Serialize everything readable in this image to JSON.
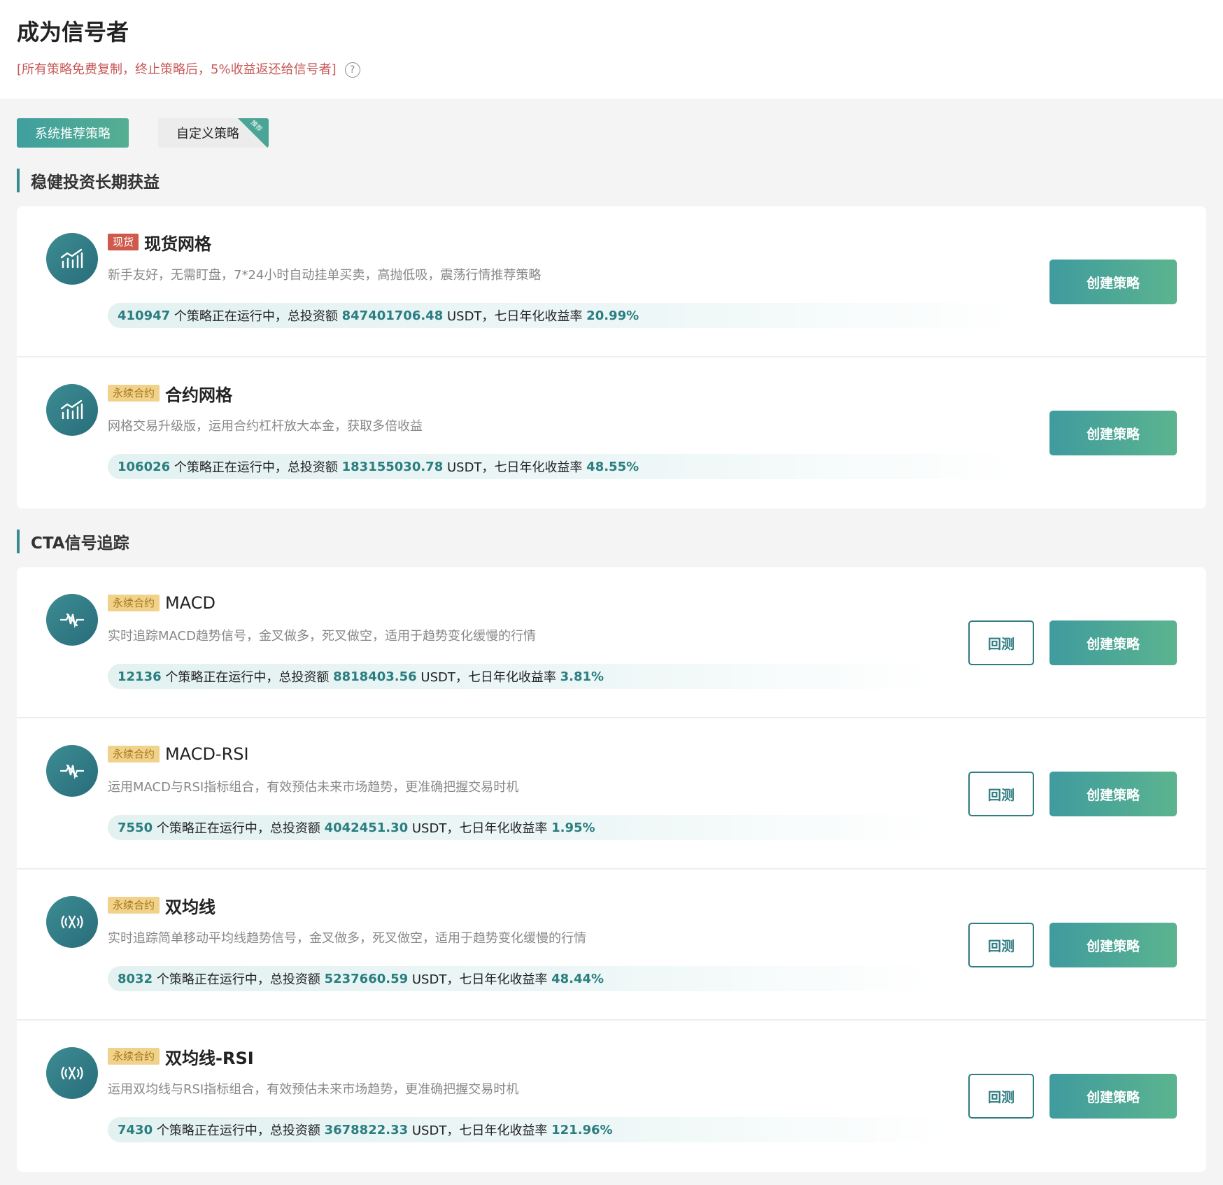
{
  "header": {
    "title": "成为信号者",
    "subtitle": "[所有策略免费复制，终止策略后，5%收益返还给信号者]",
    "help_glyph": "?"
  },
  "tabs": {
    "system": "系统推荐策略",
    "custom": "自定义策略",
    "custom_ribbon": "推荐"
  },
  "sections": [
    {
      "title": "稳健投资长期获益",
      "rows": [
        {
          "badge": "现货",
          "title": "现货网格",
          "desc": "新手友好，无需盯盘，7*24小时自动挂单买卖，高抛低吸，震荡行情推荐策略",
          "running": "410947",
          "running_label": "个策略正在运行中，总投资额",
          "amount": "847401706.48",
          "amount_label": "USDT，七日年化收益率",
          "rate": "20.99%",
          "create": "创建策略"
        },
        {
          "badge": "永续合约",
          "title": "合约网格",
          "desc": "网格交易升级版，运用合约杠杆放大本金，获取多倍收益",
          "running": "106026",
          "running_label": "个策略正在运行中，总投资额",
          "amount": "183155030.78",
          "amount_label": "USDT，七日年化收益率",
          "rate": "48.55%",
          "create": "创建策略"
        }
      ]
    },
    {
      "title": "CTA信号追踪",
      "rows": [
        {
          "badge": "永续合约",
          "title": "MACD",
          "desc": "实时追踪MACD趋势信号，金叉做多，死叉做空，适用于趋势变化缓慢的行情",
          "running": "12136",
          "running_label": "个策略正在运行中，总投资额",
          "amount": "8818403.56",
          "amount_label": "USDT，七日年化收益率",
          "rate": "3.81%",
          "backtest": "回测",
          "create": "创建策略"
        },
        {
          "badge": "永续合约",
          "title": "MACD-RSI",
          "desc": "运用MACD与RSI指标组合，有效预估未来市场趋势，更准确把握交易时机",
          "running": "7550",
          "running_label": "个策略正在运行中，总投资额",
          "amount": "4042451.30",
          "amount_label": "USDT，七日年化收益率",
          "rate": "1.95%",
          "backtest": "回测",
          "create": "创建策略"
        },
        {
          "badge": "永续合约",
          "title": "双均线",
          "desc": "实时追踪简单移动平均线趋势信号，金叉做多，死叉做空，适用于趋势变化缓慢的行情",
          "running": "8032",
          "running_label": "个策略正在运行中，总投资额",
          "amount": "5237660.59",
          "amount_label": "USDT，七日年化收益率",
          "rate": "48.44%",
          "backtest": "回测",
          "create": "创建策略"
        },
        {
          "badge": "永续合约",
          "title": "双均线-RSI",
          "desc": "运用双均线与RSI指标组合，有效预估未来市场趋势，更准确把握交易时机",
          "running": "7430",
          "running_label": "个策略正在运行中，总投资额",
          "amount": "3678822.33",
          "amount_label": "USDT，七日年化收益率",
          "rate": "121.96%",
          "backtest": "回测",
          "create": "创建策略"
        }
      ]
    }
  ],
  "icons": {
    "grid": "chart-bars-icon",
    "macd": "pulse-cross-icon",
    "ma": "signal-wave-icon"
  },
  "colors": {
    "accent": "#3f9b9e",
    "accent_end": "#5bb48f",
    "warning_red": "#c75757",
    "badge_spot": "#cf5a4c",
    "badge_perp": "#f0d28a"
  }
}
